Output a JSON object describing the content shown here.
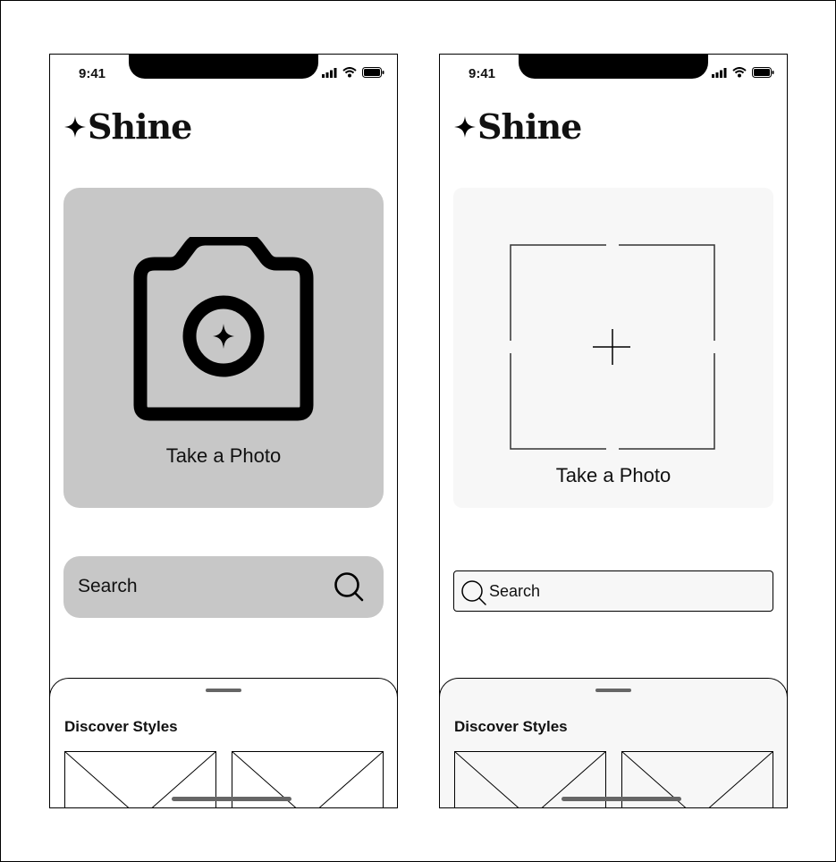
{
  "phones": [
    {
      "status": {
        "time": "9:41"
      },
      "app": {
        "name": "Shine"
      },
      "hero": {
        "label": "Take a Photo"
      },
      "search": {
        "label": "Search"
      },
      "sheet": {
        "title": "Discover Styles"
      }
    },
    {
      "status": {
        "time": "9:41"
      },
      "app": {
        "name": "Shine"
      },
      "hero": {
        "label": "Take a Photo"
      },
      "search": {
        "label": "Search"
      },
      "sheet": {
        "title": "Discover Styles"
      }
    }
  ],
  "colors": {
    "hero_a": "#c7c7c7",
    "hero_b": "#f7f7f7",
    "ink": "#111111"
  },
  "icons": [
    "sparkle-icon",
    "camera-icon",
    "search-icon",
    "signal-icon",
    "wifi-icon",
    "battery-icon",
    "plus-icon",
    "viewfinder-icon"
  ]
}
